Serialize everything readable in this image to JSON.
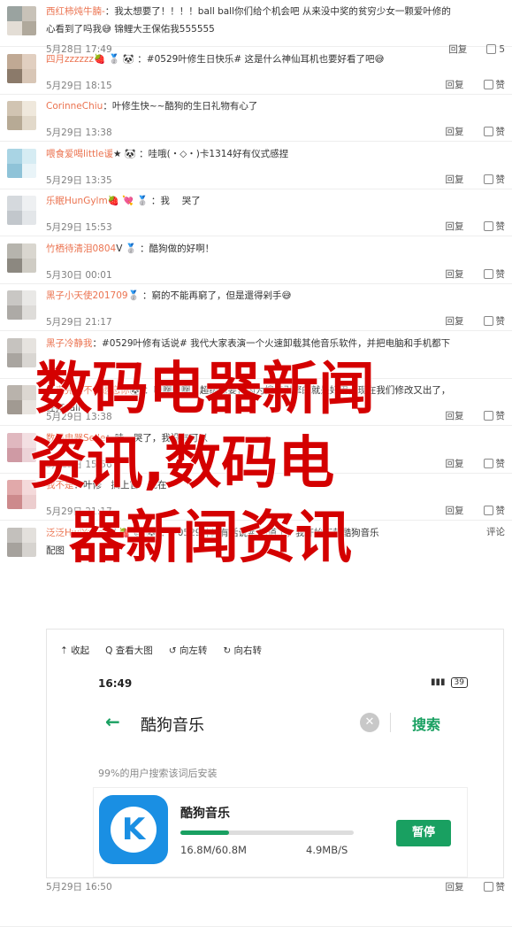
{
  "comments": [
    {
      "user": "西红柿炖牛腩-",
      "text": "：我太想要了！！！！ball ball你们给个机会吧 从来没中奖的贫穷少女一颗爱叶修的",
      "line2": "心看到了吗我😅 锦鲤大王保佑我555555",
      "time": "5月28日 17:49",
      "reply": "回复",
      "like": "5",
      "avatar": [
        "#9aa3a0",
        "#c8c2b8",
        "#e3ddd5",
        "#b0a99c"
      ]
    },
    {
      "user": "四月zzzzzz",
      "text": "🍓 🥈 🐼 ：#0529叶修生日快乐# 这是什么神仙耳机也要好看了吧😅",
      "time": "5月29日 18:15",
      "reply": "回复",
      "like": "赞",
      "avatar": [
        "#c0a994",
        "#e1cfc0",
        "#8b7a6a",
        "#d8c6b6"
      ]
    },
    {
      "user": "CorinneChiu",
      "text": "：叶修生快~~酷狗的生日礼物有心了",
      "time": "5月29日 13:38",
      "reply": "回复",
      "like": "赞",
      "avatar": [
        "#d1c4b2",
        "#efe8dc",
        "#b7aa95",
        "#e2d9ca"
      ]
    },
    {
      "user": "喂食爱喝little谖",
      "text": "★ 🐼 ：哇哦(・◇・)卡1314好有仪式感捏",
      "time": "5月29日 13:35",
      "reply": "回复",
      "like": "赞",
      "avatar": [
        "#a9d4e4",
        "#d6ecf3",
        "#8fc3d8",
        "#e9f4f8"
      ]
    },
    {
      "user": "乐眠HunGylm",
      "text": "🍓 💘 🥈 ：我　 哭了",
      "time": "5月29日 15:53",
      "reply": "回复",
      "like": "赞",
      "avatar": [
        "#d5d9dd",
        "#eef0f2",
        "#c2c7cc",
        "#e3e6e9"
      ]
    },
    {
      "user": "竹栖待清泪0804",
      "text": "V 🥈 ：酷狗做的好啊！",
      "time": "5月30日 00:01",
      "reply": "回复",
      "like": "赞",
      "avatar": [
        "#b6b4ad",
        "#d9d6cf",
        "#8c8880",
        "#cfccc4"
      ]
    },
    {
      "user": "黑子小天使201709",
      "text": "🥈 ：窮的不能再窮了，但是還得剁手😅",
      "time": "5月29日 21:17",
      "reply": "回复",
      "like": "赞",
      "avatar": [
        "#c9c7c4",
        "#e9e8e6",
        "#adaaa6",
        "#dedcd9"
      ]
    },
    {
      "user": "黑子冷静我",
      "text": "：#0529叶修有话说# 我代大家表演一个火速卸载其他音乐软件，并把电脑和手机都下",
      "time": "",
      "reply": "",
      "like": "",
      "avatar": [
        "#c6c3bf",
        "#e6e3df",
        "#a9a5a0",
        "#d9d6d2"
      ]
    },
    {
      "user": "未来完全不会遗忘你",
      "text": "🐼 ：啊啊啊啊，超级想要，因为搜索引擎的就是好用，现在我们修改又出了，",
      "line2": "狂打call",
      "time": "5月29日 13:38",
      "reply": "回复",
      "like": "赞",
      "avatar": [
        "#b9b3ac",
        "#dcd7d1",
        "#a19a92",
        "#e8e4df"
      ]
    },
    {
      "user": "数码电器Selle",
      "text": "：哇　哭了，我没有可以",
      "time": "5月29日 15:56",
      "reply": "回复",
      "like": "赞",
      "avatar": [
        "#e0b8bf",
        "#f3dfe2",
        "#cf9aa4",
        "#ecd2d7"
      ]
    },
    {
      "user": "我不是",
      "text": "：叶修　搞上官　现在",
      "time": "5月29日 21:17",
      "reply": "回复",
      "like": "赞",
      "avatar": [
        "#e1a9aa",
        "#f4d9da",
        "#cd8a8c",
        "#eccdce"
      ]
    },
    {
      "user": "泛泛HwiYoung",
      "text": "V 🍓 😎 🐼 ：#0529叶修有话说# 知道了，我开始下载酷狗音乐",
      "line2": "配图",
      "time": "5月29日 16:50",
      "reply": "回复",
      "like": "赞",
      "comment_label": "评论",
      "avatar": [
        "#c3c0bc",
        "#e3e0dc",
        "#a6a29d",
        "#d6d3cf"
      ]
    }
  ],
  "overlay": {
    "line1": "数码电器新闻",
    "line2": "资讯,数码电",
    "line3": "器新闻资讯"
  },
  "embed": {
    "toolbar": [
      "⇡ 收起",
      "Q 查看大图",
      "↺ 向左转",
      "↻ 向右转"
    ],
    "phone": {
      "time": "16:49",
      "battery": "39",
      "search_value": "酷狗音乐",
      "search_button": "搜索",
      "hint": "99%的用户搜索该词后安装",
      "app_name": "酷狗音乐",
      "app_icon_letter": "K",
      "sizes": "16.8M/60.8M",
      "speed": "4.9MB/S",
      "pause_label": "暂停",
      "progress": 0.28
    }
  },
  "colors": {
    "accent": "#eb7350",
    "green": "#19a061",
    "overlay_red": "#d40000"
  }
}
